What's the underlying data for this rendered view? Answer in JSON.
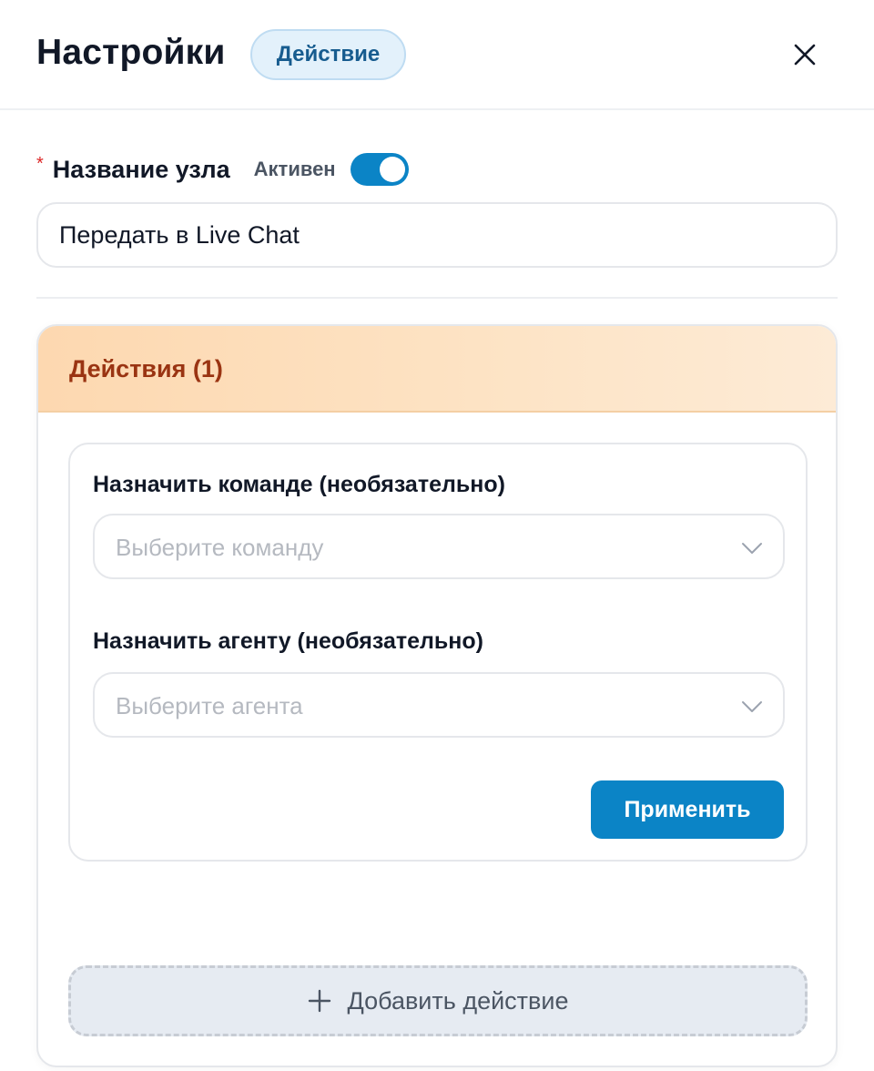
{
  "header": {
    "title": "Настройки",
    "badge": "Действие",
    "close_icon": "close-icon"
  },
  "node": {
    "label": "Название узла",
    "required_marker": "*",
    "status_label": "Активен",
    "active": true,
    "name_value": "Передать в Live Chat"
  },
  "actions": {
    "title": "Действия (1)",
    "items": [
      {
        "team_label": "Назначить команде (необязательно)",
        "team_placeholder": "Выберите команду",
        "agent_label": "Назначить агенту (необязательно)",
        "agent_placeholder": "Выберите агента",
        "apply_label": "Применить"
      }
    ],
    "add_label": "Добавить действие"
  },
  "colors": {
    "accent": "#0b84c6",
    "badge_bg": "#e3f1fb",
    "badge_text": "#175c8f",
    "actions_title": "#9a3412",
    "required": "#dc2626"
  }
}
